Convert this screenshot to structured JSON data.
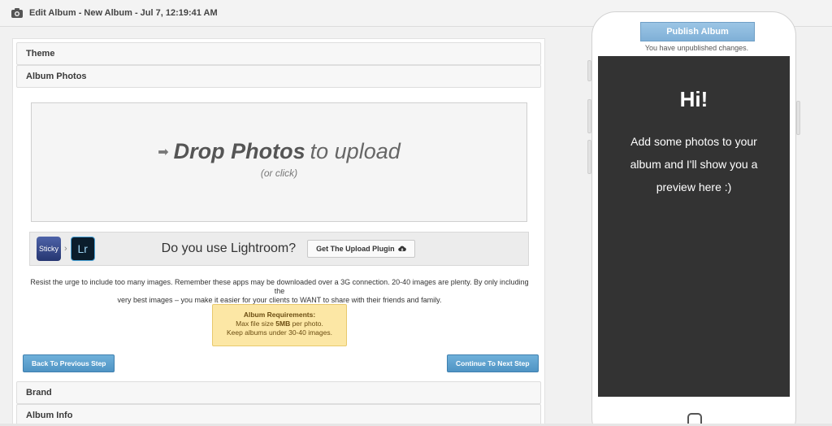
{
  "header": {
    "title": "Edit Album - New Album - Jul 7, 12:19:41 AM",
    "icon": "camera-icon"
  },
  "sections": {
    "theme": "Theme",
    "album_photos": "Album Photos",
    "brand": "Brand",
    "album_info": "Album Info"
  },
  "dropzone": {
    "main_strong": "Drop Photos",
    "main_light": "to upload",
    "sub": "(or click)",
    "icon": "arrow-right-icon"
  },
  "lightroom": {
    "sticky_label": "Sticky",
    "lr_label": "Lr",
    "question": "Do you use Lightroom?",
    "plugin_button": "Get The Upload Plugin",
    "plugin_icon": "cloud-download-icon"
  },
  "advice": {
    "line1": "Resist the urge to include too many images. Remember these apps may be downloaded over a 3G connection. 20-40 images are plenty. By only including the",
    "line2": "very best images – you make it easier for your clients to WANT to share with their friends and family."
  },
  "requirements": {
    "title": "Album Requirements:",
    "line1_pre": "Max file size ",
    "line1_bold": "5MB",
    "line1_post": " per photo.",
    "line2": "Keep albums under 30-40 images."
  },
  "nav": {
    "back": "Back To Previous Step",
    "next": "Continue To Next Step"
  },
  "preview": {
    "publish": "Publish Album",
    "unpublished": "You have unpublished changes.",
    "hi": "Hi!",
    "message": "Add some photos to your album and I'll show you a preview here :)"
  },
  "colors": {
    "accent_blue": "#4f94c4",
    "requirements_bg": "#fce7a5",
    "screen_bg": "#333333"
  }
}
